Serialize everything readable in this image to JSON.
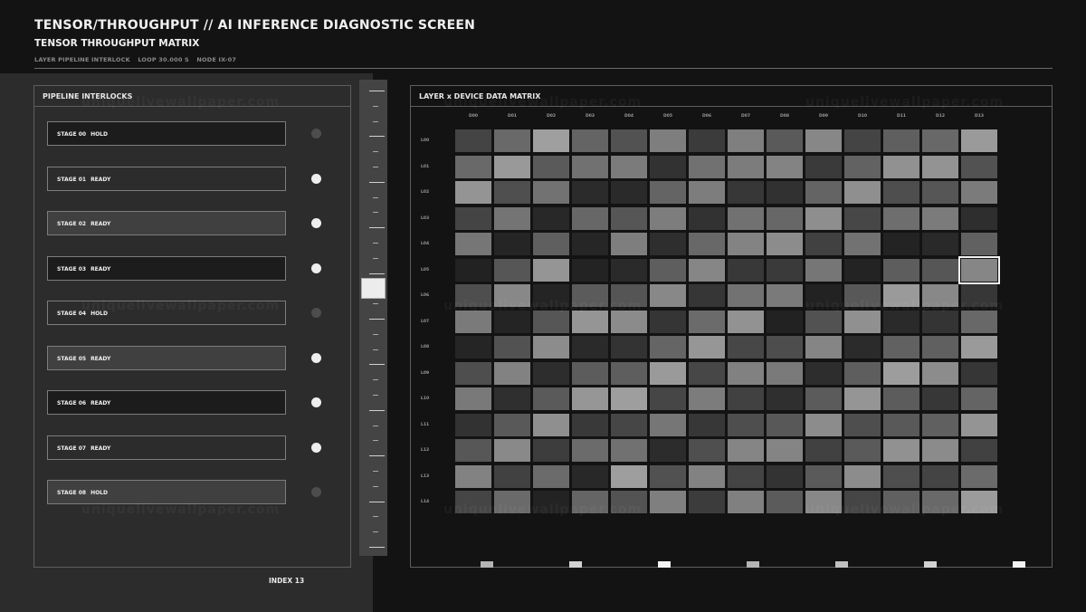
{
  "header": {
    "title": "TENSOR/THROUGHPUT // AI INFERENCE DIAGNOSTIC SCREEN",
    "subtitle": "TENSOR THROUGHPUT MATRIX",
    "meta": [
      "LAYER PIPELINE INTERLOCK",
      "LOOP 30.000 S",
      "NODE IX-07"
    ]
  },
  "pipeline": {
    "title": "PIPELINE INTERLOCKS",
    "stages": [
      {
        "num": "STAGE 00",
        "status": "HOLD",
        "on": false,
        "fill": "#1b1c1b"
      },
      {
        "num": "STAGE 01",
        "status": "READY",
        "on": true,
        "fill": "#2b2c2b"
      },
      {
        "num": "STAGE 02",
        "status": "READY",
        "on": true,
        "fill": "#3f403f"
      },
      {
        "num": "STAGE 03",
        "status": "READY",
        "on": true,
        "fill": "#1b1c1b"
      },
      {
        "num": "STAGE 04",
        "status": "HOLD",
        "on": false,
        "fill": "#2b2c2b"
      },
      {
        "num": "STAGE 05",
        "status": "READY",
        "on": true,
        "fill": "#3f403f"
      },
      {
        "num": "STAGE 06",
        "status": "READY",
        "on": true,
        "fill": "#1b1c1b"
      },
      {
        "num": "STAGE 07",
        "status": "READY",
        "on": true,
        "fill": "#2b2c2b"
      },
      {
        "num": "STAGE 08",
        "status": "HOLD",
        "on": false,
        "fill": "#3f403f"
      }
    ],
    "index_label": "INDEX 13"
  },
  "matrix": {
    "title": "LAYER x DEVICE DATA MATRIX",
    "columns": [
      "D00",
      "D01",
      "D02",
      "D03",
      "D04",
      "D05",
      "D06",
      "D07",
      "D08",
      "D09",
      "D10",
      "D11",
      "D12",
      "D13"
    ],
    "rows": [
      "L00",
      "L01",
      "L02",
      "L03",
      "L04",
      "L05",
      "L06",
      "L07",
      "L08",
      "L09",
      "L10",
      "L11",
      "L12",
      "L13",
      "L14"
    ],
    "selected": {
      "row": 5,
      "col": 13
    },
    "footer_marks": [
      "#b4b4b4",
      "#d2d2d2",
      "#f2f2f2",
      "#b4b4b4",
      "#c0c0c0",
      "#d2d2d2",
      "#f2f2f2"
    ]
  },
  "watermark": "uniquelivewallpaper.com"
}
